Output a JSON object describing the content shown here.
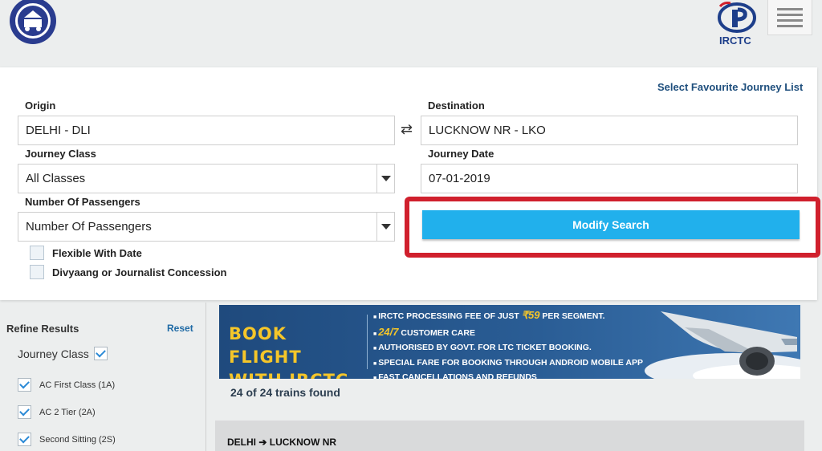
{
  "header": {
    "left_logo_icon": "indian-railways-emblem-icon",
    "right_logo_text": "IRCTC",
    "menu_icon": "hamburger-menu-icon"
  },
  "search": {
    "favourite_link": "Select Favourite Journey List",
    "origin_label": "Origin",
    "origin_value": "DELHI - DLI",
    "destination_label": "Destination",
    "destination_value": "LUCKNOW NR - LKO",
    "swap_icon": "swap-arrows-icon",
    "swap_glyph": "⇄",
    "journey_class_label": "Journey Class",
    "journey_class_value": "All Classes",
    "journey_date_label": "Journey Date",
    "journey_date_value": "07-01-2019",
    "passengers_label": "Number Of Passengers",
    "passengers_value": "Number Of Passengers",
    "modify_button": "Modify Search",
    "flexible_label": "Flexible With Date",
    "concession_label": "Divyaang or Journalist Concession"
  },
  "refine": {
    "title": "Refine Results",
    "reset": "Reset",
    "journey_class_label": "Journey Class",
    "classes": [
      {
        "label": "AC First Class (1A)",
        "checked": true
      },
      {
        "label": "AC 2 Tier (2A)",
        "checked": true
      },
      {
        "label": "Second Sitting (2S)",
        "checked": true
      }
    ]
  },
  "banner": {
    "headline_1": "BOOK FLIGHT",
    "headline_2": "WITH IRCTC",
    "points": [
      {
        "pre": "IRCTC PROCESSING FEE OF JUST ",
        "em": "₹59",
        "post": " PER SEGMENT."
      },
      {
        "pre": "",
        "em": "24/7",
        "post": " CUSTOMER CARE"
      },
      {
        "pre": "AUTHORISED BY GOVT. FOR LTC TICKET BOOKING.",
        "em": "",
        "post": ""
      },
      {
        "pre": "SPECIAL FARE FOR BOOKING THROUGH  ANDROID MOBILE APP",
        "em": "",
        "post": ""
      },
      {
        "pre": "FAST CANCELLATIONS AND REFUNDS",
        "em": "",
        "post": ""
      }
    ],
    "image_icon": "airplane-icon"
  },
  "results": {
    "count_text": "24 of 24 trains found",
    "route_from": "DELHI",
    "route_arrow": "➔",
    "route_to": "LUCKNOW NR"
  },
  "colors": {
    "accent_button": "#21b0ec",
    "highlight_border": "#d0202d",
    "link": "#1f4f7d",
    "banner_yellow": "#f5c629"
  }
}
